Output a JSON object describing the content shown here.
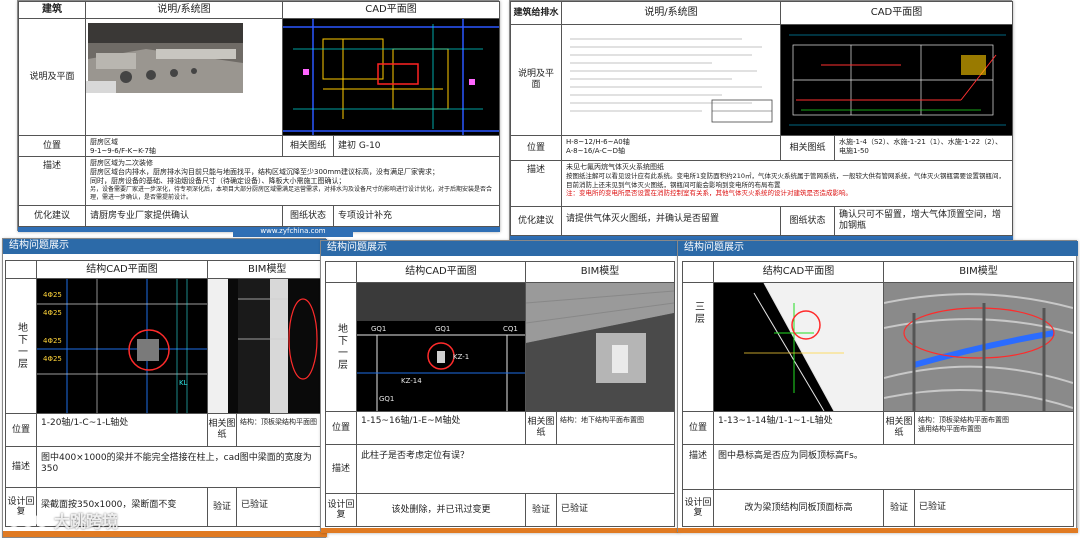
{
  "panel1": {
    "header_col1": "建筑",
    "header_col2": "说明/系统图",
    "header_col3": "CAD平面图",
    "row_label_desc": "说明及平面",
    "position_label": "位置",
    "position_value": "厨房区域\n9-1~9-6/F-K~K-7轴",
    "related_label": "相关图纸",
    "related_value": "建初 G-10",
    "describe_label": "描述",
    "describe_lines": [
      "厨房区域为二次装修",
      "厨房区域台内排水，厨房排水沟目前只能与地面找平，结构区域沉降至少300mm建议标高，没有满足厂家需求；",
      "同时，厨房设备的基础、排油烟设备尺寸（待确定设备）、降板大小需施工图确认；",
      "另，设备需要厂家进一步深化，待专项深化后，本项目大部分厨房区域需满足运营需求，对排水沟及设备尺寸的影响进行设计优化，对于后期安装是否合理，需进一步确认，是否需提前设计。"
    ],
    "optimize_label": "优化建议",
    "optimize_value": "请厨房专业厂家提供确认",
    "status_label": "图纸状态",
    "status_value": "专项设计补充",
    "footer_url": "www.zyfchina.com"
  },
  "panel2": {
    "header_col1": "建筑给排水",
    "header_col2": "说明/系统图",
    "header_col3": "CAD平面图",
    "row_label_desc": "说明及平面",
    "position_label": "位置",
    "position_value": "H-8~12/H-6~A0轴\nA-8~16/A-C~D轴",
    "related_label": "相关图纸",
    "related_value": "水施-1-4（S2）、水施-1-21（1）、水施-1-22（2）、电施1-50",
    "describe_label": "描述",
    "describe_line1": "未见七氟丙烷气体灭火系统图纸",
    "describe_line2": "按图纸注解可以看见设计应有此系统。变电所1变防面积约210㎡，气体灭火系统属于管网系统，一般较大供有管网系统，气体灭火钢瓶需要设置钢瓶间，目前消防上还未见到气体灭火图纸，钢瓶间可能会影响到变电所的布局布置",
    "describe_line3": "注：变电所的变电所是否设置在消防控制室有关系，其他气体灭火系统的设计对建筑是否造成影响。",
    "optimize_label": "优化建议",
    "optimize_value": "请提供气体灭火图纸，并确认是否留置",
    "status_label": "图纸状态",
    "status_value": "确认只可不留置，增大气体顶置空间，增加钢瓶"
  },
  "panel3": {
    "banner": "结构问题展示",
    "header_cad": "结构CAD平面图",
    "header_bim": "BIM模型",
    "floor_label": "地下一层",
    "position_label": "位置",
    "position_value": "1-20轴/1-C~1-L轴处",
    "related_label": "相关图纸",
    "related_value": "结构：顶板梁结构平面图",
    "describe_label": "描述",
    "describe_value": "图中400×1000的梁并不能完全搭接在柱上，cad图中梁面的宽度为350",
    "reply_label": "设计回复",
    "reply_value": "梁截面按350x1000，梁断面不变",
    "verify_label": "验证",
    "verify_value": "已验证",
    "cad_labels": [
      "4Φ25",
      "4Φ25",
      "4Φ25",
      "4Φ25",
      "KL"
    ]
  },
  "panel4": {
    "banner": "结构问题展示",
    "header_cad": "结构CAD平面图",
    "header_bim": "BIM模型",
    "floor_label": "地下一层",
    "position_label": "位置",
    "position_value": "1-15~16轴/1-E~M轴处",
    "related_label": "相关图纸",
    "related_value": "结构：地下结构平面布置图",
    "describe_label": "描述",
    "describe_value": "此柱子是否考虑定位有误？",
    "reply_label": "设计回复",
    "reply_value": "该处删除，并已讯过变更",
    "verify_label": "验证",
    "verify_value": "已验证",
    "cad_labels": [
      "GQ1",
      "GQ1",
      "CQ1",
      "KZ-1",
      "KZ-14",
      "GQ1"
    ]
  },
  "panel5": {
    "banner": "结构问题展示",
    "header_cad": "结构CAD平面图",
    "header_bim": "BIM模型",
    "floor_label": "三层",
    "position_label": "位置",
    "position_value": "1-13~1-14轴/1-1~1-L轴处",
    "related_label": "相关图纸",
    "related_value": "结构：顶板梁结构平面布置图\n通用结构平面布置图",
    "describe_label": "描述",
    "describe_value": "图中悬标高是否应为同板顶标高Fs。",
    "reply_label": "设计回复",
    "reply_value": "改为梁顶结构同板顶面标高",
    "verify_label": "验证",
    "verify_value": "已验证"
  },
  "watermark": "大跳跨境"
}
